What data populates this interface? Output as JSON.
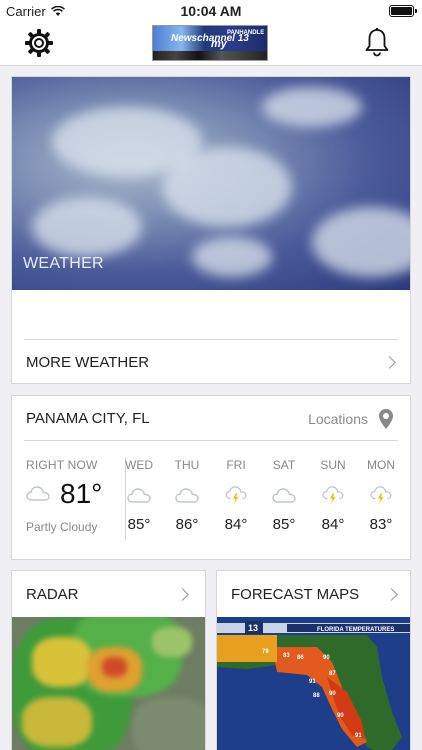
{
  "status_bar": {
    "carrier": "Carrier",
    "time": "10:04 AM"
  },
  "nav": {
    "logo_text_1": "Newschannel 13",
    "logo_text_2": "my",
    "logo_text_3": "PANHANDLE"
  },
  "weather_card": {
    "image_label": "WEATHER",
    "more_label": "MORE WEATHER"
  },
  "forecast": {
    "city": "PANAMA CITY, FL",
    "locations_label": "Locations",
    "now": {
      "header": "RIGHT NOW",
      "temp": "81°",
      "condition": "Partly Cloudy",
      "icon": "cloud-icon"
    },
    "days": [
      {
        "name": "WED",
        "temp": "85°",
        "icon": "cloud-icon"
      },
      {
        "name": "THU",
        "temp": "86°",
        "icon": "cloud-icon"
      },
      {
        "name": "FRI",
        "temp": "84°",
        "icon": "thunderstorm-icon"
      },
      {
        "name": "SAT",
        "temp": "85°",
        "icon": "cloud-icon"
      },
      {
        "name": "SUN",
        "temp": "84°",
        "icon": "thunderstorm-icon"
      },
      {
        "name": "MON",
        "temp": "83°",
        "icon": "thunderstorm-icon"
      }
    ]
  },
  "radar_card": {
    "title": "RADAR"
  },
  "maps_card": {
    "title": "FORECAST MAPS",
    "map_banner": "FLORIDA TEMPERATURES",
    "map_badge": "13",
    "map_values": [
      "79",
      "83",
      "86",
      "90",
      "91",
      "87",
      "88",
      "90",
      "90",
      "91"
    ]
  },
  "colors": {
    "accent_cloud": "#bfc6d3",
    "bolt": "#f2c200",
    "radar_heavy": "#e0a030",
    "map_hot": "#e05020"
  }
}
